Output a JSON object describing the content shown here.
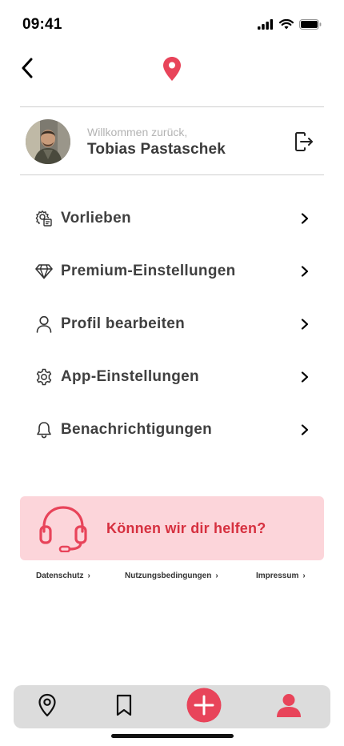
{
  "status_bar": {
    "time": "09:41"
  },
  "colors": {
    "accent": "#e8445a",
    "help_background": "#fcd5da",
    "help_text": "#d6303f",
    "tab_bar": "#dcdcdc"
  },
  "nav": {
    "back_icon": "chevron-left-icon",
    "logo_icon": "map-pin-icon"
  },
  "profile": {
    "welcome_text": "Willkommen zurück,",
    "name": "Tobias Pastaschek",
    "logout_icon": "logout-icon"
  },
  "menu": {
    "items": [
      {
        "label": "Vorlieben",
        "icon": "preferences-gear-icon"
      },
      {
        "label": "Premium-Einstellungen",
        "icon": "diamond-icon"
      },
      {
        "label": "Profil bearbeiten",
        "icon": "user-icon"
      },
      {
        "label": "App-Einstellungen",
        "icon": "gear-icon"
      },
      {
        "label": "Benachrichtigungen",
        "icon": "bell-icon"
      }
    ]
  },
  "help": {
    "label": "Können wir dir helfen?",
    "icon": "headset-icon"
  },
  "footer": {
    "links": [
      {
        "label": "Datenschutz",
        "chevron": "›"
      },
      {
        "label": "Nutzungsbedingungen",
        "chevron": "›"
      },
      {
        "label": "Impressum",
        "chevron": "›"
      }
    ]
  },
  "tab_bar": {
    "tabs": [
      {
        "icon": "map-pin-icon",
        "active": false
      },
      {
        "icon": "bookmark-icon",
        "active": false
      },
      {
        "icon": "add-icon",
        "active": false
      },
      {
        "icon": "profile-icon",
        "active": true
      }
    ]
  }
}
